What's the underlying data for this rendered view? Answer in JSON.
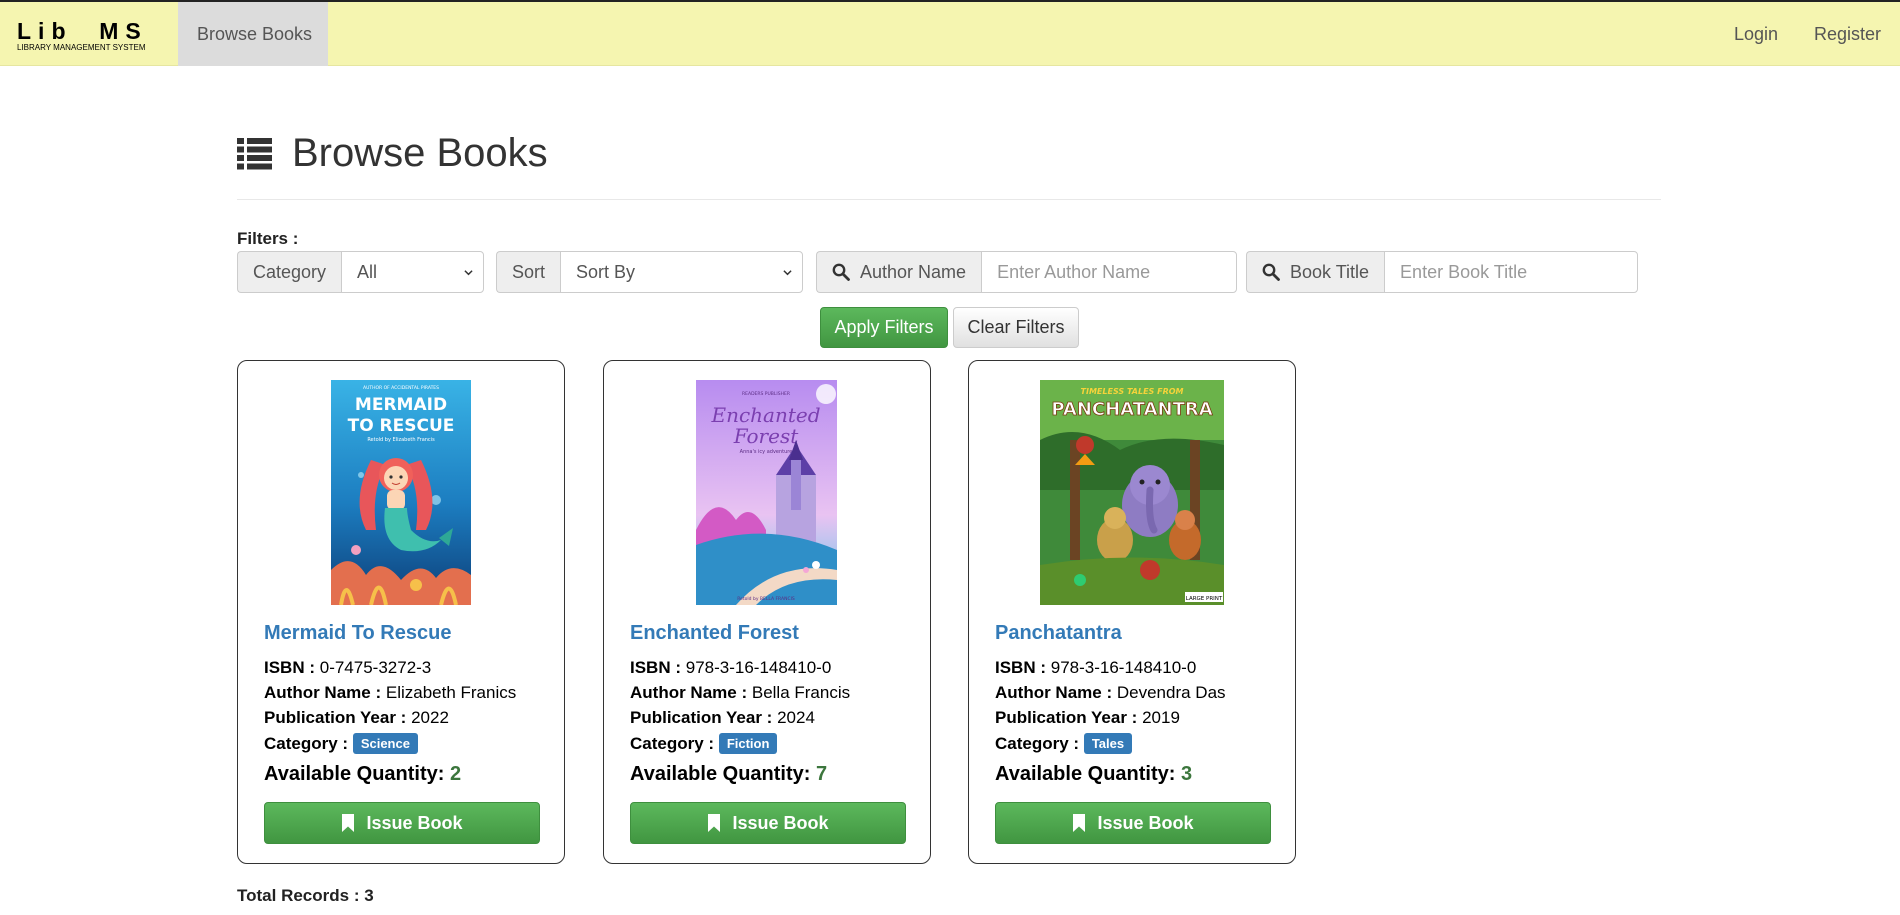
{
  "brand": {
    "title": "Lib  MS",
    "subtitle": "LIBRARY MANAGEMENT SYSTEM"
  },
  "nav": {
    "browse": "Browse Books",
    "login": "Login",
    "register": "Register"
  },
  "page": {
    "title": "Browse Books",
    "icon": "list-icon"
  },
  "filters": {
    "label": "Filters :",
    "category_label": "Category",
    "category_value": "All",
    "sort_label": "Sort",
    "sort_value": "Sort By",
    "author_label": "Author Name",
    "author_placeholder": "Enter Author Name",
    "title_label": "Book Title",
    "title_placeholder": "Enter Book Title",
    "apply": "Apply Filters",
    "clear": "Clear Filters"
  },
  "labels": {
    "isbn": "ISBN :",
    "author": "Author Name :",
    "year": "Publication Year :",
    "category": "Category :",
    "quantity": "Available Quantity:",
    "issue": "Issue Book"
  },
  "books": [
    {
      "title": "Mermaid To Rescue",
      "isbn": "0-7475-3272-3",
      "author": "Elizabeth Franics",
      "year": "2022",
      "category": "Science",
      "quantity": "2",
      "cover": {
        "top_text": "AUTHOR OF ACCIDENTAL PIRATES",
        "line1": "MERMAID",
        "line2": "TO RESCUE",
        "sub": "Retold by Elizabeth Francis"
      }
    },
    {
      "title": "Enchanted Forest",
      "isbn": "978-3-16-148410-0",
      "author": "Bella Francis",
      "year": "2024",
      "category": "Fiction",
      "quantity": "7",
      "cover": {
        "top_text": "READERS PUBLISHER",
        "line1": "Enchanted",
        "line2": "Forest",
        "sub": "Anna's icy adventure",
        "bottom": "Retold by BELLA FRANCIS"
      }
    },
    {
      "title": "Panchatantra",
      "isbn": "978-3-16-148410-0",
      "author": "Devendra Das",
      "year": "2019",
      "category": "Tales",
      "quantity": "3",
      "cover": {
        "top_text": "TIMELESS TALES FROM",
        "line1": "PANCHATANTRA",
        "corner": "LARGE PRINT"
      }
    }
  ],
  "total": "Total Records : 3",
  "colors": {
    "navbar": "#f5f5b0",
    "link": "#337ab7",
    "green": "#5cb85c",
    "qty": "#3c763d"
  }
}
